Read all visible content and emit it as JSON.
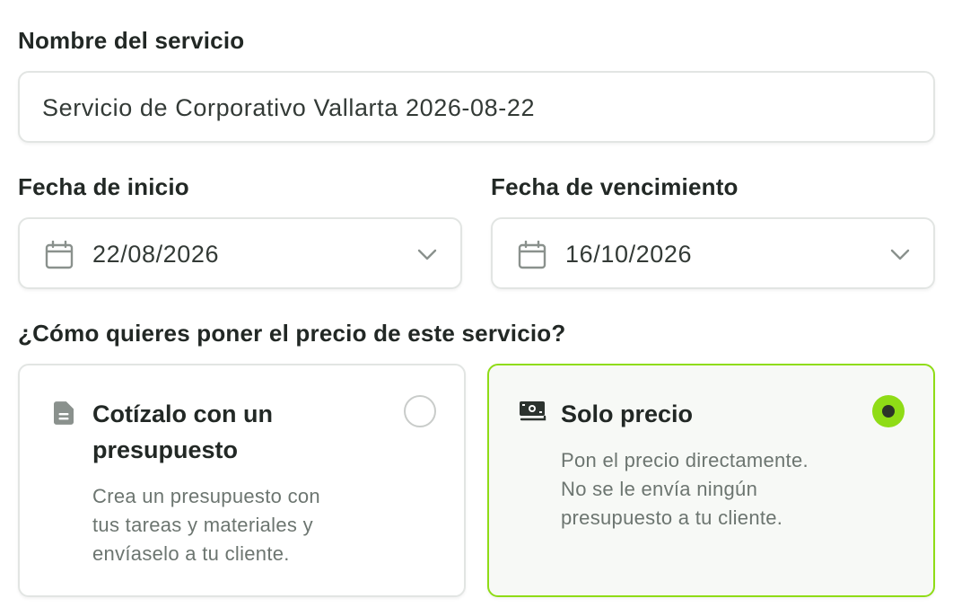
{
  "service_name": {
    "label": "Nombre del servicio",
    "value": "Servicio de Corporativo Vallarta 2026-08-22"
  },
  "start_date": {
    "label": "Fecha de inicio",
    "value": "22/08/2026",
    "icon": "calendar-icon"
  },
  "due_date": {
    "label": "Fecha de vencimiento",
    "value": "16/10/2026",
    "icon": "calendar-icon"
  },
  "pricing": {
    "question": "¿Cómo quieres poner el precio de este servicio?",
    "options": [
      {
        "title_line1": "Cotízalo con un",
        "title_line2": "presupuesto",
        "desc_line1": "Crea un presupuesto con",
        "desc_line2": "tus tareas y materiales y",
        "desc_line3": "envíaselo a tu cliente.",
        "icon": "document-icon",
        "selected": false
      },
      {
        "title_line1": "Solo precio",
        "desc_line1": "Pon el precio directamente.",
        "desc_line2": "No se le envía ningún",
        "desc_line3": "presupuesto a tu cliente.",
        "icon": "cash-icon",
        "selected": true
      }
    ]
  },
  "colors": {
    "accent": "#8fdc16",
    "border": "#e2e5e3",
    "muted_text": "#6c7570"
  }
}
